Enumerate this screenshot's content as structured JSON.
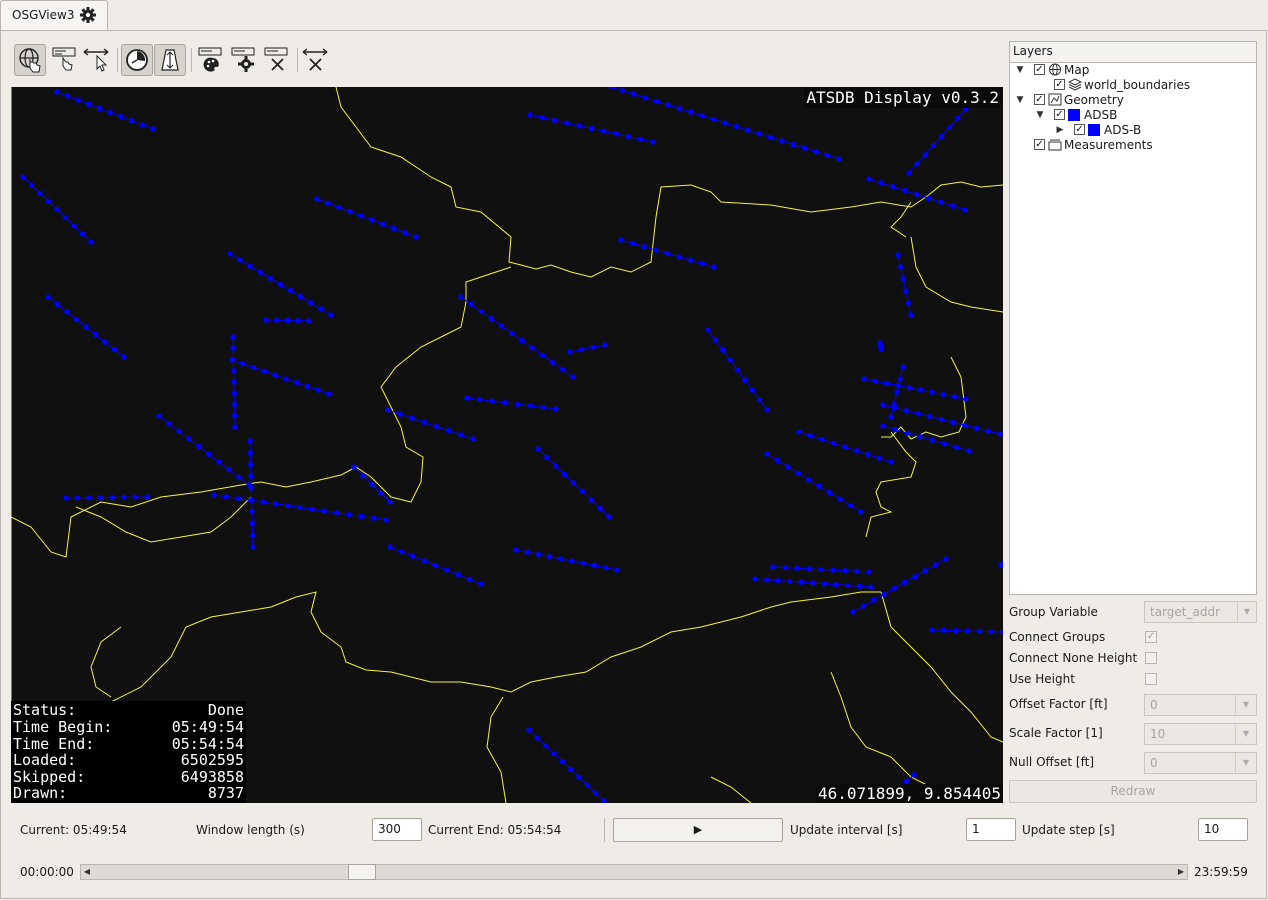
{
  "window": {
    "tab_title": "OSGView3",
    "tab_icon": "gear-icon"
  },
  "toolbar": {
    "buttons": [
      {
        "name": "navigate-globe-hand-icon",
        "checked": true
      },
      {
        "name": "label-hand-icon",
        "checked": false
      },
      {
        "name": "measure-arrow-cursor-icon",
        "checked": false
      },
      {
        "name": "time-filter-clock-icon",
        "checked": true
      },
      {
        "name": "height-filter-icon",
        "checked": true
      },
      {
        "name": "label-palette-icon",
        "checked": false
      },
      {
        "name": "label-settings-gear-icon",
        "checked": false
      },
      {
        "name": "label-clear-icon",
        "checked": false
      },
      {
        "name": "measure-clear-icon",
        "checked": false
      }
    ]
  },
  "map": {
    "title": "ATSDB Display v0.3.2",
    "coordinates": "46.071899, 9.854405",
    "colors": {
      "background": "#101010",
      "boundaries": "#f5f53a",
      "tracks": "#0000ff"
    },
    "status": [
      {
        "key": "Status:",
        "value": "Done"
      },
      {
        "key": "Time Begin:",
        "value": "05:49:54"
      },
      {
        "key": "Time End:",
        "value": "05:54:54"
      },
      {
        "key": "Loaded:",
        "value": "6502595"
      },
      {
        "key": "Skipped:",
        "value": "6493858"
      },
      {
        "key": "Drawn:",
        "value": "8737"
      }
    ]
  },
  "layers": {
    "header": "Layers",
    "tree": [
      {
        "label": "Map",
        "level": 0,
        "arrow": "down",
        "checked": true,
        "icon": "globe-icon"
      },
      {
        "label": "world_boundaries",
        "level": 1,
        "arrow": "",
        "checked": true,
        "icon": "layers-stack-icon"
      },
      {
        "label": "Geometry",
        "level": 0,
        "arrow": "down",
        "checked": true,
        "icon": "geometry-icon"
      },
      {
        "label": "ADSB",
        "level": 1,
        "arrow": "down",
        "checked": true,
        "icon": "blue-square",
        "color": "#0000ff"
      },
      {
        "label": "ADS-B",
        "level": 2,
        "arrow": "right",
        "checked": true,
        "icon": "blue-square",
        "color": "#0000ff"
      },
      {
        "label": "Measurements",
        "level": 0,
        "arrow": "",
        "checked": true,
        "icon": "measure-icon"
      }
    ]
  },
  "properties": {
    "group_variable": {
      "label": "Group Variable",
      "value": "target_addr"
    },
    "connect_groups": {
      "label": "Connect Groups",
      "checked": true
    },
    "connect_none_height": {
      "label": "Connect None Height",
      "checked": false
    },
    "use_height": {
      "label": "Use Height",
      "checked": false
    },
    "offset_factor": {
      "label": "Offset Factor [ft]",
      "value": "0"
    },
    "scale_factor": {
      "label": "Scale Factor [1]",
      "value": "10"
    },
    "null_offset": {
      "label": "Null Offset [ft]",
      "value": "0"
    },
    "redraw_label": "Redraw"
  },
  "controls": {
    "current_label": "Current: 05:49:54",
    "window_length_label": "Window length (s)",
    "window_length_value": "300",
    "current_end_label": "Current End: 05:54:54",
    "play_symbol": "▶",
    "update_interval_label": "Update interval [s]",
    "update_interval_value": "1",
    "update_step_label": "Update step [s]",
    "update_step_value": "10",
    "time_start": "00:00:00",
    "time_end": "23:59:59",
    "slider_position": 0.2416
  }
}
